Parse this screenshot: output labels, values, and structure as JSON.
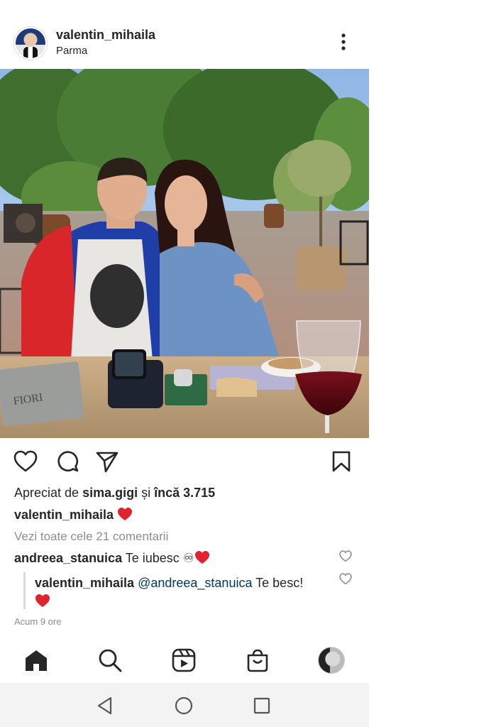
{
  "post": {
    "username": "valentin_mihaila",
    "location": "Parma"
  },
  "likes": {
    "prefix": "Apreciat de ",
    "user": "sima.gigi",
    "middle": " și ",
    "count": "încă 3.715"
  },
  "caption": {
    "username": "valentin_mihaila",
    "emoji": "heart"
  },
  "view_all_comments": "Vezi toate cele 21 comentarii",
  "comment": {
    "username": "andreea_stanuica",
    "text": "Te iubesc ♾",
    "emoji": "heart"
  },
  "reply": {
    "username": "valentin_mihaila",
    "mention": "@andreea_stanuica",
    "text": "Te besc!",
    "emoji": "heart"
  },
  "timestamp": "Acum 9 ore",
  "icons": {
    "like": "heart-outline-icon",
    "comment": "comment-bubble-icon",
    "share": "send-icon",
    "save": "bookmark-icon",
    "more": "more-vertical-icon"
  },
  "nav": [
    "home-icon",
    "search-icon",
    "reels-icon",
    "shop-icon",
    "profile-avatar"
  ],
  "colors": {
    "heart": "#e0242f",
    "link": "#00376b",
    "muted": "#8e8e8e"
  },
  "photo_sign_text": "FIORI"
}
